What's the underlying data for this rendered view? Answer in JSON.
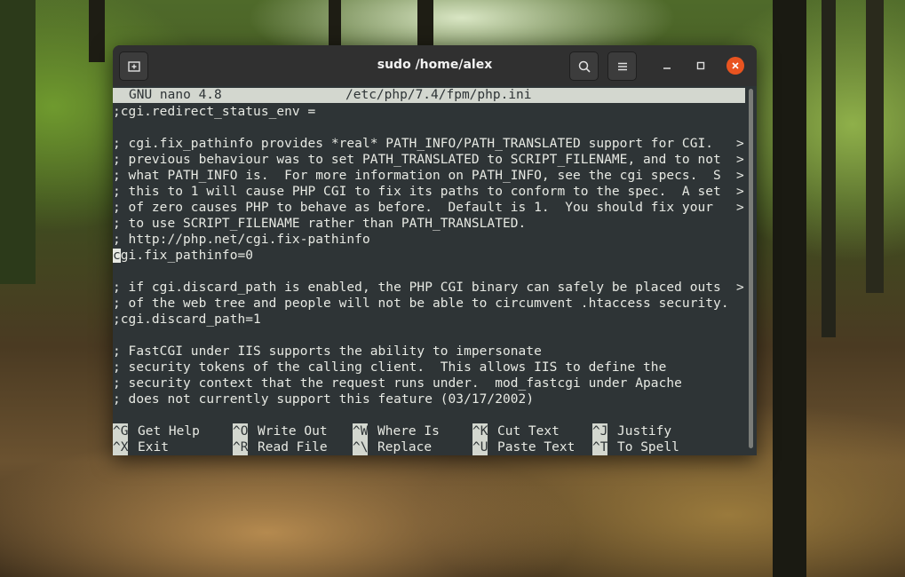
{
  "window": {
    "title": "sudo /home/alex"
  },
  "nano": {
    "version": "GNU nano 4.8",
    "filename": "/etc/php/7.4/fpm/php.ini",
    "lines": [
      ";cgi.redirect_status_env =",
      "",
      "; cgi.fix_pathinfo provides *real* PATH_INFO/PATH_TRANSLATED support for CGI.",
      "; previous behaviour was to set PATH_TRANSLATED to SCRIPT_FILENAME, and to not",
      "; what PATH_INFO is.  For more information on PATH_INFO, see the cgi specs.  S",
      "; this to 1 will cause PHP CGI to fix its paths to conform to the spec.  A set",
      "; of zero causes PHP to behave as before.  Default is 1.  You should fix your",
      "; to use SCRIPT_FILENAME rather than PATH_TRANSLATED.",
      "; http://php.net/cgi.fix-pathinfo",
      "gi.fix_pathinfo=0",
      "",
      "; if cgi.discard_path is enabled, the PHP CGI binary can safely be placed outs",
      "; of the web tree and people will not be able to circumvent .htaccess security.",
      ";cgi.discard_path=1",
      "",
      "; FastCGI under IIS supports the ability to impersonate",
      "; security tokens of the calling client.  This allows IIS to define the",
      "; security context that the request runs under.  mod_fastcgi under Apache",
      "; does not currently support this feature (03/17/2002)"
    ],
    "cursor_char": "c",
    "overflow_marker": ">",
    "shortcuts": [
      {
        "key": "^G",
        "label": "Get Help"
      },
      {
        "key": "^O",
        "label": "Write Out"
      },
      {
        "key": "^W",
        "label": "Where Is"
      },
      {
        "key": "^K",
        "label": "Cut Text"
      },
      {
        "key": "^J",
        "label": "Justify"
      },
      {
        "key": "^X",
        "label": "Exit"
      },
      {
        "key": "^R",
        "label": "Read File"
      },
      {
        "key": "^\\",
        "label": "Replace"
      },
      {
        "key": "^U",
        "label": "Paste Text"
      },
      {
        "key": "^T",
        "label": "To Spell"
      }
    ]
  },
  "colors": {
    "accent_close": "#e95420",
    "terminal_bg": "#2e3436",
    "terminal_fg": "#e7e9e3",
    "inverse_bg": "#d3d7cf"
  }
}
